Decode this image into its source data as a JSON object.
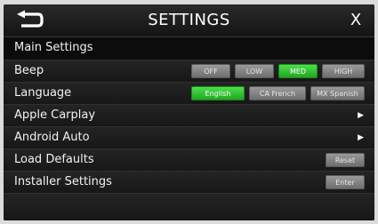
{
  "header": {
    "title": "SETTINGS",
    "close_label": "X",
    "back_icon": "back-arrow-icon"
  },
  "main_settings": {
    "heading": "Main Settings"
  },
  "beep": {
    "label": "Beep",
    "options": [
      "OFF",
      "LOW",
      "MED",
      "HIGH"
    ],
    "selected": "MED"
  },
  "language": {
    "label": "Language",
    "options": [
      "English",
      "CA French",
      "MX Spanish"
    ],
    "selected": "English"
  },
  "apple_carplay": {
    "label": "Apple Carplay",
    "arrow": "▶"
  },
  "android_auto": {
    "label": "Android Auto",
    "arrow": "▶"
  },
  "load_defaults": {
    "label": "Load Defaults",
    "button": "Reset"
  },
  "installer_settings": {
    "label": "Installer Settings",
    "button": "Enter"
  },
  "colors": {
    "active_option": "#3ccc3c",
    "inactive_option": "#858585",
    "background": "#0c0c0c"
  }
}
